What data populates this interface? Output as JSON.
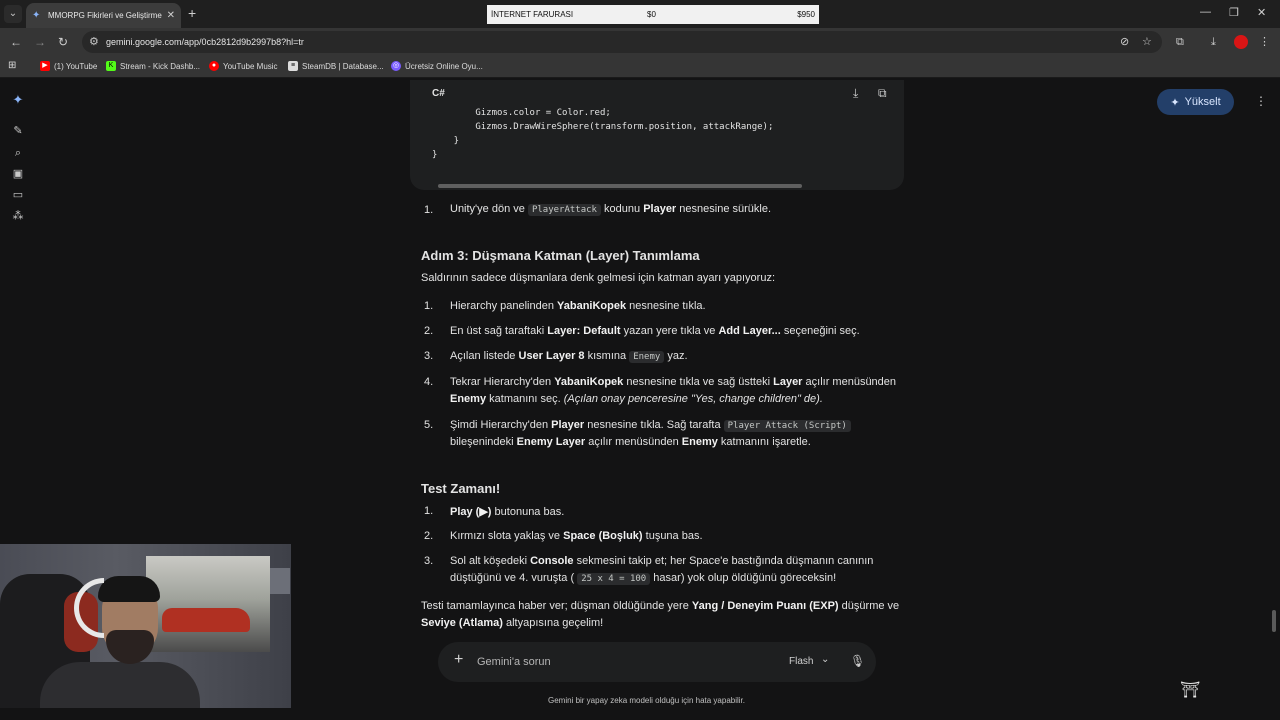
{
  "browser": {
    "tab_title": "MMORPG Fikirleri ve Geliştirme",
    "extension_banner": {
      "label": "İNTERNET FARURASI",
      "amount_current": "$0",
      "amount_max": "$950"
    },
    "url": "gemini.google.com/app/0cb2812d9b2997b8?hl=tr",
    "bookmarks": [
      {
        "label": "(1) YouTube",
        "icon": "youtube-icon",
        "color": "#ff0000"
      },
      {
        "label": "Stream - Kick Dashb...",
        "icon": "kick-icon",
        "color": "#53fc18"
      },
      {
        "label": "YouTube Music",
        "icon": "youtube-music-icon",
        "color": "#ff0000"
      },
      {
        "label": "SteamDB | Database...",
        "icon": "steamdb-icon",
        "color": "#ffffff"
      },
      {
        "label": "Ücretsiz Online Oyu...",
        "icon": "game-icon",
        "color": "#7a5cff"
      }
    ]
  },
  "gemini": {
    "upgrade_label": "Yükselt",
    "code": {
      "lang": "C#",
      "lines": [
        "        Gizmos.color = Color.red;",
        "        Gizmos.DrawWireSphere(transform.position, attackRange);",
        "    }",
        "}"
      ]
    },
    "step_a": {
      "num": "1.",
      "pre": "Unity'ye dön ve",
      "code": "PlayerAttack",
      "mid": "kodunu",
      "bold": "Player",
      "post": "nesnesine sürükle."
    },
    "adim3": {
      "title": "Adım 3: Düşmana Katman (Layer) Tanımlama",
      "intro": "Saldırının sadece düşmanlara denk gelmesi için katman ayarı yapıyoruz:",
      "items": {
        "i1": {
          "num": "1.",
          "a": "Hierarchy panelinden",
          "b": "YabaniKopek",
          "c": "nesnesine tıkla."
        },
        "i2": {
          "num": "2.",
          "a": "En üst sağ taraftaki",
          "b": "Layer: Default",
          "c": "yazan yere tıkla ve",
          "d": "Add Layer...",
          "e": "seçeneğini seç."
        },
        "i3": {
          "num": "3.",
          "a": "Açılan listede",
          "b": "User Layer 8",
          "c": "kısmına",
          "code": "Enemy",
          "d": "yaz."
        },
        "i4": {
          "num": "4.",
          "a": "Tekrar Hierarchy'den",
          "b": "YabaniKopek",
          "c": "nesnesine tıkla ve sağ üstteki",
          "d": "Layer",
          "e": "açılır menüsünden",
          "f": "Enemy",
          "g": "katmanını seç.",
          "h": "(Açılan onay penceresine \"Yes, change children\" de)."
        },
        "i5": {
          "num": "5.",
          "a": "Şimdi Hierarchy'den",
          "b": "Player",
          "c": "nesnesine tıkla. Sağ tarafta",
          "code": "Player Attack (Script)",
          "d": "bileşenindeki",
          "e": "Enemy Layer",
          "f": "açılır menüsünden",
          "g": "Enemy",
          "h": "katmanını işaretle."
        }
      }
    },
    "test": {
      "title": "Test Zamanı!",
      "items": {
        "i1": {
          "num": "1.",
          "b": "Play (▶)",
          "c": "butonuna bas."
        },
        "i2": {
          "num": "2.",
          "a": "Kırmızı slota yaklaş ve",
          "b": "Space (Boşluk)",
          "c": "tuşuna bas."
        },
        "i3": {
          "num": "3.",
          "a": "Sol alt köşedeki",
          "b": "Console",
          "c": "sekmesini takip et; her Space'e bastığında düşmanın canının",
          "d": "düştüğünü ve 4. vuruşta (",
          "code": "25 x 4 = 100",
          "e": "hasar) yok olup öldüğünü göreceksin!"
        }
      }
    },
    "outro": {
      "a": "Testi tamamlayınca haber ver; düşman öldüğünde yere",
      "b": "Yang / Deneyim Puanı (EXP)",
      "c": "düşürme ve",
      "d": "Seviye (Atlama)",
      "e": "altyapısına geçelim!"
    },
    "input": {
      "placeholder": "Gemini'a sorun",
      "model": "Flash"
    },
    "disclaimer": "Gemini bir yapay zeka modeli olduğu için hata yapabilir."
  }
}
